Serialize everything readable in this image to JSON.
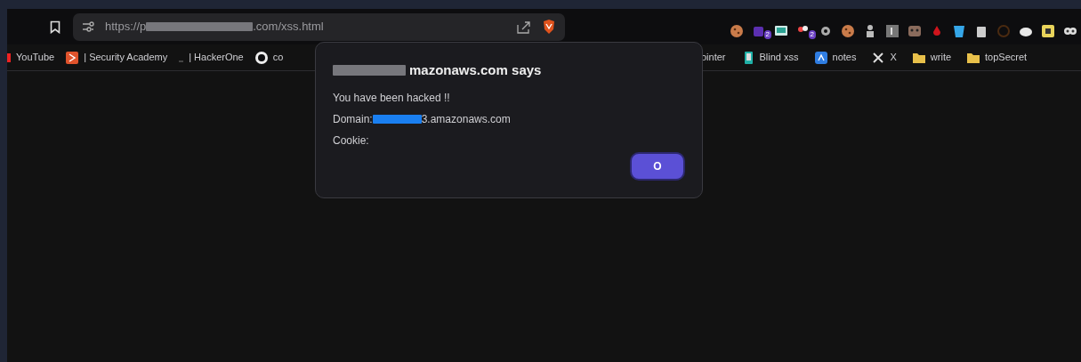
{
  "address_bar": {
    "url_start": "https://p",
    "url_end": ".com/xss.html"
  },
  "extensions": [
    {
      "kind": "cookie"
    },
    {
      "kind": "stack",
      "badge": "2"
    },
    {
      "kind": "screen"
    },
    {
      "kind": "dots",
      "badge": "2"
    },
    {
      "kind": "gear"
    },
    {
      "kind": "cookie"
    },
    {
      "kind": "figure"
    },
    {
      "kind": "square"
    },
    {
      "kind": "mask"
    },
    {
      "kind": "drop"
    },
    {
      "kind": "cup"
    },
    {
      "kind": "bin"
    },
    {
      "kind": "target"
    },
    {
      "kind": "cloud"
    },
    {
      "kind": "tile"
    },
    {
      "kind": "eyes"
    }
  ],
  "bookmarks_left": [
    {
      "kind": "red",
      "label": "YouTube"
    },
    {
      "kind": "orange",
      "label": "| Security Academy"
    },
    {
      "kind": "dark",
      "label": "| HackerOne"
    },
    {
      "kind": "github",
      "label": "co"
    }
  ],
  "bookmarks_right": [
    {
      "kind": "none",
      "label": "ointer"
    },
    {
      "kind": "phone",
      "label": "Blind xss"
    },
    {
      "kind": "blue",
      "label": "notes"
    },
    {
      "kind": "x",
      "label": "X"
    },
    {
      "kind": "folder",
      "label": "write"
    },
    {
      "kind": "folder",
      "label": "topSecret"
    }
  ],
  "dialog": {
    "title": "mazonaws.com says",
    "lines": [
      {
        "kind": "plain",
        "text": "You have been hacked !!"
      },
      {
        "kind": "redacted",
        "prefix": "Domain:",
        "text": "3.amazonaws.com"
      },
      {
        "kind": "plain",
        "text": "Cookie:"
      }
    ],
    "button": "O"
  }
}
